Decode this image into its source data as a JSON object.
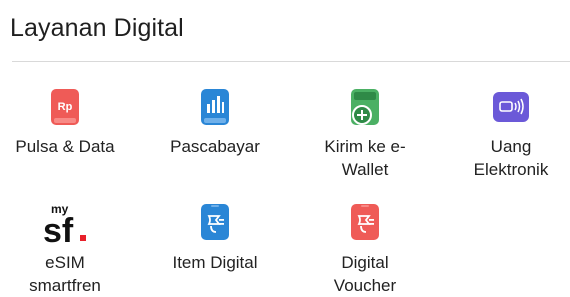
{
  "section": {
    "title": "Layanan Digital"
  },
  "items": [
    {
      "id": "pulsa",
      "icon_name": "pulsa-rp-icon",
      "label_lines": [
        "Pulsa & Data"
      ],
      "color": "#ef5b57"
    },
    {
      "id": "pascabayar",
      "icon_name": "pascabayar-bar-chart-icon",
      "label_lines": [
        "Pascabayar"
      ],
      "color": "#2a86d6"
    },
    {
      "id": "ewallet",
      "icon_name": "kirim-ewallet-icon",
      "label_lines": [
        "Kirim ke e-",
        "Wallet"
      ],
      "color": "#4bb064"
    },
    {
      "id": "uang",
      "icon_name": "uang-elektronik-nfc-icon",
      "label_lines": [
        "Uang",
        "Elektronik"
      ],
      "color": "#6b59d8"
    },
    {
      "id": "esim",
      "icon_name": "smartfren-logo",
      "label_lines": [
        "eSIM",
        "smartfren"
      ],
      "logo_text": "sf",
      "logo_small_text": "my",
      "color": "#111111",
      "accent": "#e8202a"
    },
    {
      "id": "item-digital",
      "icon_name": "item-digital-icon",
      "label_lines": [
        "Item Digital"
      ],
      "color": "#2a86d6"
    },
    {
      "id": "digital-voucher",
      "icon_name": "digital-voucher-icon",
      "label_lines": [
        "Digital",
        "Voucher"
      ],
      "color": "#ef5b57"
    }
  ]
}
